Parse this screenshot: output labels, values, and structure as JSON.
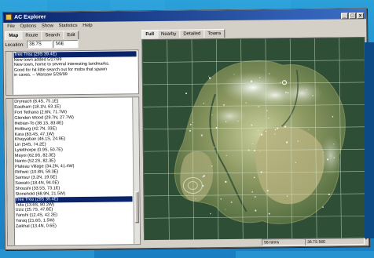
{
  "window": {
    "title": "AC Explorer"
  },
  "title_buttons": [
    "_",
    "□",
    "x"
  ],
  "menu": [
    "File",
    "Options",
    "Show",
    "Statistics",
    "Help"
  ],
  "left_tabs": [
    "Map",
    "Route",
    "Search",
    "Edit"
  ],
  "location": {
    "label": "Location:",
    "value1": "38.7S",
    "value2": "56E"
  },
  "notes": {
    "selected": "Tree Trea (29S 39.4E)",
    "lines": [
      "New town added 5/27/99",
      "New town, home to several interesting landmarks.",
      "Good for hit little search out for mobs that spawn",
      "in caves.  -- Warsaw 5/29/99"
    ]
  },
  "places": [
    "Dryreach (8.4S, 75.1E)",
    "Eastham (18.1N, 63.1E)",
    "Fort Tethana (2.6N, 71.7W)",
    "Glenden Wood (29.7N, 27.7W)",
    "Hebian-To (38.1S, 83.8E)",
    "Holtburg (42.7N, 33E)",
    "Kara (83.4S, 47.1W)",
    "Khayyaban (46.1S, 24.9E)",
    "Lin (54S, 74.2E)",
    "Lytelthorpe (0.9S, 50.7E)",
    "Mayoi (62.9S, 82.3E)",
    "Nanto (52.2S, 82.3E)",
    "Plateau Village (34.2N, 41.4W)",
    "Rithwic (10.8N, 59.3E)",
    "Samsur (3.2N, 19.5E)",
    "Sawato (18.4N, 94.0E)",
    "Shoushi (33.5S, 73.1E)",
    "Stonehold (68.9N, 21.5W)",
    "Tree Trea (29S 39.4E)",
    "Tufa (13.6S, 80.2W)",
    "Uziz (25.7S, 47.8E)",
    "Yanshi (12.4S, 42.2E)",
    "Yaraq (21.6S, 1.5W)",
    "Zaikhal (13.4N, 0.6E)"
  ],
  "selected_place": "Tree Trea (29S 39.4E)",
  "map_tabs": [
    "Full",
    "Nearby",
    "Detailed",
    "Towns"
  ],
  "status": {
    "items": "56 Items",
    "coords": "38.7S 56E"
  },
  "colors": {
    "selection": "#0a246a",
    "titlebar": "#0a246a",
    "map_bg": "#2f4e36",
    "grid": "#cfe3c8"
  }
}
